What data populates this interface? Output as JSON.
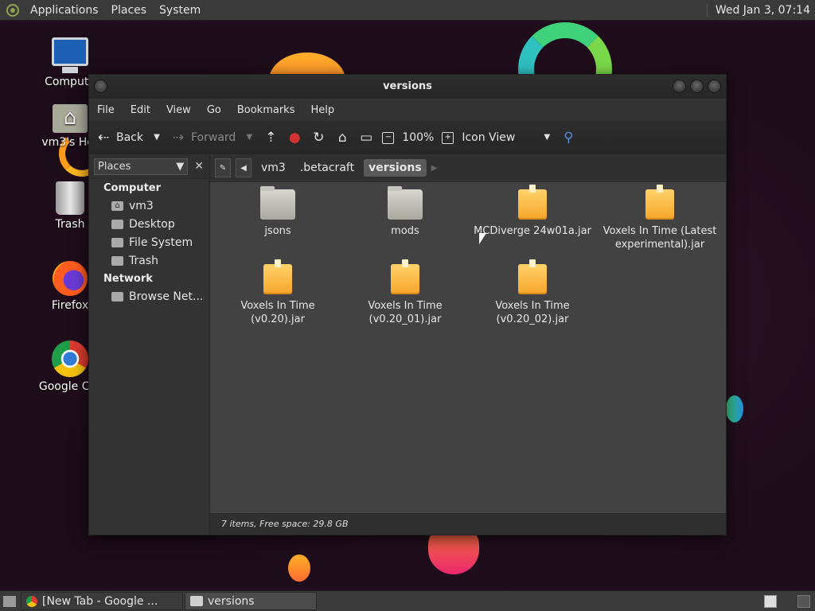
{
  "top_panel": {
    "menus": [
      "Applications",
      "Places",
      "System"
    ],
    "clock": "Wed Jan  3, 07:14"
  },
  "desktop_icons": [
    {
      "label": "Compute",
      "icon": "computer-icon"
    },
    {
      "label": "vm3's Hor",
      "icon": "home-folder-icon"
    },
    {
      "label": "Trash",
      "icon": "trash-icon"
    },
    {
      "label": "Firefox",
      "icon": "firefox-icon"
    },
    {
      "label": "Google Chr",
      "icon": "chrome-icon"
    }
  ],
  "window": {
    "title": "versions",
    "menu": [
      "File",
      "Edit",
      "View",
      "Go",
      "Bookmarks",
      "Help"
    ],
    "toolbar": {
      "back": "Back",
      "forward": "Forward",
      "zoom": "100%",
      "view_mode": "Icon View"
    },
    "sidebar": {
      "selector": "Places",
      "groups": [
        {
          "title": "Computer",
          "items": [
            "vm3",
            "Desktop",
            "File System",
            "Trash"
          ]
        },
        {
          "title": "Network",
          "items": [
            "Browse Net..."
          ]
        }
      ]
    },
    "path": [
      "vm3",
      ".betacraft",
      "versions"
    ],
    "files": [
      {
        "name": "jsons",
        "type": "folder"
      },
      {
        "name": "mods",
        "type": "folder"
      },
      {
        "name": "MCDiverge 24w01a.jar",
        "type": "jar"
      },
      {
        "name": "Voxels In Time (Latest experimental).jar",
        "type": "jar"
      },
      {
        "name": "Voxels In Time (v0.20).jar",
        "type": "jar"
      },
      {
        "name": "Voxels In Time (v0.20_01).jar",
        "type": "jar"
      },
      {
        "name": "Voxels In Time (v0.20_02).jar",
        "type": "jar"
      }
    ],
    "status": "7 items, Free space: 29.8 GB"
  },
  "taskbar": {
    "tasks": [
      "[New Tab - Google ...",
      "versions"
    ]
  },
  "colors": {
    "panel": "#3a3a3a",
    "window_bg": "#3b3b3b",
    "content_bg": "#424242",
    "stop_red": "#d23333"
  }
}
